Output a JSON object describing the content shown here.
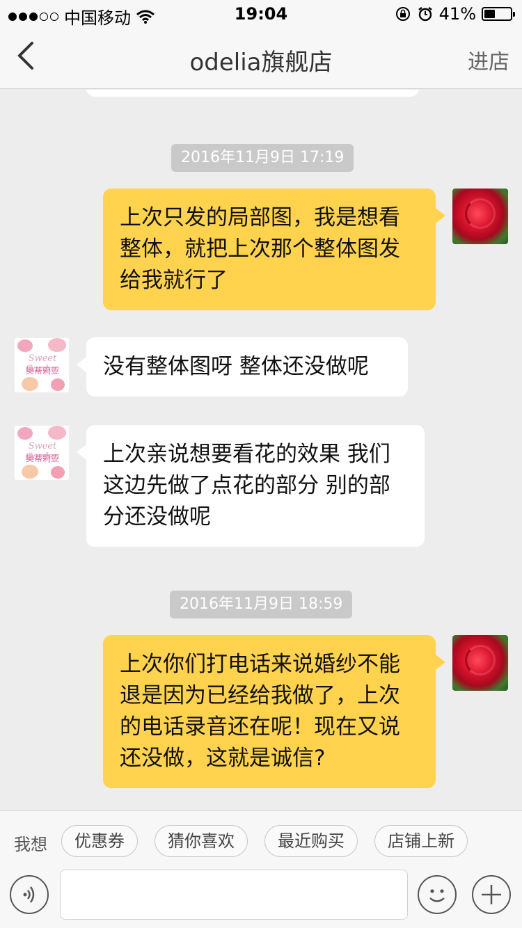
{
  "status_bar": {
    "carrier": "中国移动",
    "time": "19:04",
    "battery": "41%",
    "battery_level": 0.41
  },
  "nav": {
    "back_icon": "chevron-left-icon",
    "title": "odelia旗舰店",
    "right_label": "进店"
  },
  "chat": {
    "messages": [
      {
        "type": "timestamp",
        "text": "2016年11月9日 17:19"
      },
      {
        "type": "me",
        "text": "上次只发的局部图，我是想看整体，就把上次那个整体图发给我就行了"
      },
      {
        "type": "them",
        "text": "没有整体图呀 整体还没做呢"
      },
      {
        "type": "them",
        "text": "上次亲说想要看花的效果 我们这边先做了点花的部分 别的部分还没做呢"
      },
      {
        "type": "timestamp",
        "text": "2016年11月9日 18:59"
      },
      {
        "type": "me",
        "text": "上次你们打电话来说婚纱不能退是因为已经给我做了，上次的电话录音还在呢！现在又说还没做，这就是诚信?"
      }
    ],
    "shop_avatar_script": "Sweet Garden",
    "shop_avatar_name": "奥蒂莉亚"
  },
  "quick_replies": {
    "label": "我想",
    "chips": [
      "优惠券",
      "猜你喜欢",
      "最近购买",
      "店铺上新"
    ]
  },
  "input": {
    "value": "",
    "placeholder": "",
    "voice_icon": "voice-icon",
    "emoji_icon": "emoji-icon",
    "plus_icon": "plus-icon"
  },
  "colors": {
    "my_bubble": "#ffd34d",
    "their_bubble": "#ffffff",
    "background": "#ededed"
  }
}
